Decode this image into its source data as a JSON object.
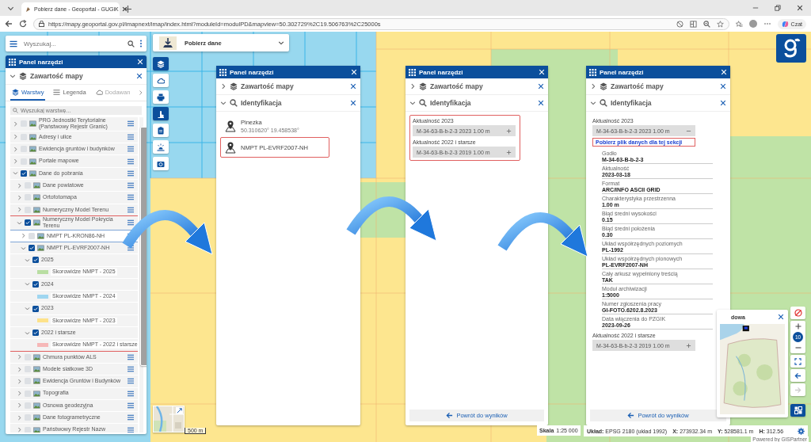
{
  "browser": {
    "tab_title": "Pobierz dane - Geoportal - GUGiK",
    "url": "https://mapy.geoportal.gov.pl/imapnext/imap/index.html?moduleId=modulPD&mapview=50.302729%2C19.506763%2C25000s",
    "chat_button": "Czat"
  },
  "search": {
    "placeholder": "Wyszukaj..."
  },
  "module_selector": {
    "label": "Pobierz dane"
  },
  "toolbar": [
    {
      "kind": "layers",
      "selected": true
    },
    {
      "kind": "cloud",
      "selected": false
    },
    {
      "kind": "print",
      "selected": false
    },
    {
      "kind": "hand",
      "selected": true
    },
    {
      "kind": "clipboard",
      "selected": false
    },
    {
      "kind": "siren",
      "selected": false
    },
    {
      "kind": "camera",
      "selected": false
    }
  ],
  "left_panel": {
    "title": "Panel narzędzi",
    "section": {
      "title": "Zawartość mapy",
      "expanded": true
    },
    "tabs": [
      {
        "label": "Warstwy",
        "kind": "layers",
        "selected": true
      },
      {
        "label": "Legenda",
        "kind": "list",
        "selected": false
      },
      {
        "label": "Dodawan",
        "kind": "cloud",
        "selected": false
      }
    ],
    "layer_search": {
      "placeholder": "Wyszukaj warstwę..."
    },
    "layers": [
      {
        "label": "PRG Jednostki Terytorialne (Państwowy Rejestr Granic)",
        "kind": "group",
        "checked": false,
        "expanded": false
      },
      {
        "label": "Adresy i ulice",
        "kind": "group",
        "checked": false,
        "expanded": false
      },
      {
        "label": "Ewidencja gruntów i budynków",
        "kind": "group",
        "checked": false,
        "expanded": false
      },
      {
        "label": "Portale mapowe",
        "kind": "group",
        "checked": false,
        "expanded": false
      },
      {
        "label": "Dane do pobrania",
        "kind": "group",
        "checked": true,
        "expanded": true,
        "children": [
          {
            "label": "Dane powiatowe",
            "kind": "group",
            "checked": false,
            "expanded": false
          },
          {
            "label": "Ortofotomapa",
            "kind": "group",
            "checked": false,
            "expanded": false
          },
          {
            "label": "Numeryczny Model Terenu",
            "kind": "group",
            "checked": false,
            "expanded": false
          },
          {
            "label": "Numeryczny Model Pokrycia Terenu",
            "kind": "group",
            "checked": true,
            "expanded": true,
            "highlighted": true,
            "children": [
              {
                "label": "NMPT PL-KRON86-NH",
                "kind": "group",
                "checked": false,
                "expanded": false,
                "focused": true
              },
              {
                "label": "NMPT PL-EVRF2007-NH",
                "kind": "group",
                "checked": true,
                "expanded": true,
                "focused": false,
                "children": [
                  {
                    "label": "2025",
                    "checked": true,
                    "expanded": true,
                    "children": [
                      {
                        "label": "Skorowidze NMPT - 2025",
                        "color": "#b9dea2"
                      }
                    ]
                  },
                  {
                    "label": "2024",
                    "checked": true,
                    "expanded": true,
                    "children": [
                      {
                        "label": "Skorowidze NMPT - 2024",
                        "color": "#9fd6f0"
                      }
                    ]
                  },
                  {
                    "label": "2023",
                    "checked": true,
                    "expanded": true,
                    "children": [
                      {
                        "label": "Skorowidze NMPT - 2023",
                        "color": "#fde28a"
                      }
                    ]
                  },
                  {
                    "label": "2022 i starsze",
                    "checked": true,
                    "expanded": true,
                    "children": [
                      {
                        "label": "Skorowidze NMPT - 2022 i starsze",
                        "color": "#f6b7b7"
                      }
                    ]
                  }
                ]
              }
            ]
          },
          {
            "label": "Chmura punktów ALS",
            "kind": "group",
            "checked": false,
            "expanded": false
          },
          {
            "label": "Modele siatkowe 3D",
            "kind": "group",
            "checked": false,
            "expanded": false
          },
          {
            "label": "Ewidencja Gruntów i Budynków",
            "kind": "group",
            "checked": false,
            "expanded": false
          },
          {
            "label": "Topografia",
            "kind": "group",
            "checked": false,
            "expanded": false
          },
          {
            "label": "Osnowa geodezyjna",
            "kind": "group",
            "checked": false,
            "expanded": false
          },
          {
            "label": "Dane fotogrametryczne",
            "kind": "group",
            "checked": false,
            "expanded": false
          },
          {
            "label": "Państwowy Rejestr Nazw",
            "kind": "group",
            "checked": false,
            "expanded": false
          }
        ]
      }
    ]
  },
  "tool_panels": [
    {
      "title": "Panel narzędzi",
      "sections": [
        {
          "title": "Zawartość mapy",
          "kind": "layers",
          "expanded": false
        },
        {
          "title": "Identyfikacja",
          "kind": "search",
          "expanded": true
        }
      ],
      "results": [
        {
          "title": "Pinezka",
          "subtitle": "50.310620° 19.458538°",
          "highlighted": false
        },
        {
          "title": "NMPT PL-EVRF2007-NH",
          "highlighted": true
        }
      ]
    },
    {
      "title": "Panel narzędzi",
      "sections": [
        {
          "title": "Zawartość mapy",
          "kind": "layers",
          "expanded": false
        },
        {
          "title": "Identyfikacja",
          "kind": "search",
          "expanded": true
        }
      ],
      "groups_highlighted": true,
      "groups": [
        {
          "heading": "Aktualność 2023",
          "items": [
            {
              "label": "M-34-63-B-b-2-3 2023 1.00 m",
              "expanded": false
            }
          ]
        },
        {
          "heading": "Aktualność 2022 i starsze",
          "items": [
            {
              "label": "M-34-63-B-b-2-3 2019 1.00 m",
              "expanded": false
            }
          ]
        }
      ],
      "back_button": "Powrót do wyników"
    },
    {
      "title": "Panel narzędzi",
      "sections": [
        {
          "title": "Zawartość mapy",
          "kind": "layers",
          "expanded": false
        },
        {
          "title": "Identyfikacja",
          "kind": "search",
          "expanded": true
        }
      ],
      "groups_highlighted": false,
      "groups": [
        {
          "heading": "Aktualność 2023",
          "items": [
            {
              "label": "M-34-63-B-b-2-3 2023 1.00 m",
              "expanded": true,
              "download_link": {
                "label": "Pobierz plik danych dla tej sekcji",
                "highlighted": true
              },
              "attributes": [
                {
                  "label": "Godło",
                  "value": "M-34-63-B-b-2-3"
                },
                {
                  "label": "Aktualność",
                  "value": "2023-03-18"
                },
                {
                  "label": "Format",
                  "value": "ARC/INFO ASCII GRID"
                },
                {
                  "label": "Charakterystyka przestrzenna",
                  "value": "1.00 m"
                },
                {
                  "label": "Błąd średni wysokości",
                  "value": "0.15"
                },
                {
                  "label": "Błąd średni położenia",
                  "value": "0.30"
                },
                {
                  "label": "Układ współrzędnych poziomych",
                  "value": "PL-1992"
                },
                {
                  "label": "Układ współrzędnych pionowych",
                  "value": "PL-EVRF2007-NH"
                },
                {
                  "label": "Cały arkusz wypełniony treścią",
                  "value": "TAK"
                },
                {
                  "label": "Moduł archiwizacji",
                  "value": "1:5000"
                },
                {
                  "label": "Numer zgłoszenia pracy",
                  "value": "GI-FOTO.6202.8.2023"
                },
                {
                  "label": "Data włączenia do PZGIK",
                  "value": "2023-09-26"
                }
              ]
            }
          ]
        },
        {
          "heading": "Aktualność 2022 i starsze",
          "items": [
            {
              "label": "M-34-63-B-b-2-3 2019 1.00 m",
              "expanded": false
            }
          ]
        }
      ],
      "back_button": "Powrót do wyników"
    }
  ],
  "callout_arrows": [
    {
      "kind": "curved-arrow"
    },
    {
      "kind": "curved-arrow"
    },
    {
      "kind": "curved-arrow"
    }
  ],
  "overview_map": {
    "title": "dowa"
  },
  "map_controls": {
    "zoom_level": "10",
    "back_disabled": false,
    "forward_disabled": true,
    "basemap_selected": true
  },
  "thumbnail": {
    "scale": "500 m"
  },
  "status": {
    "scale_label": "Skala",
    "scale": "1:25 000",
    "items": [
      "**Układ:** EPSG 2180 (układ 1992)",
      "**X:** 273932.34 m",
      "**Y:** 528581.1 m",
      "**H:** 312.56"
    ]
  },
  "powered_by": "Powered by GISPartner"
}
